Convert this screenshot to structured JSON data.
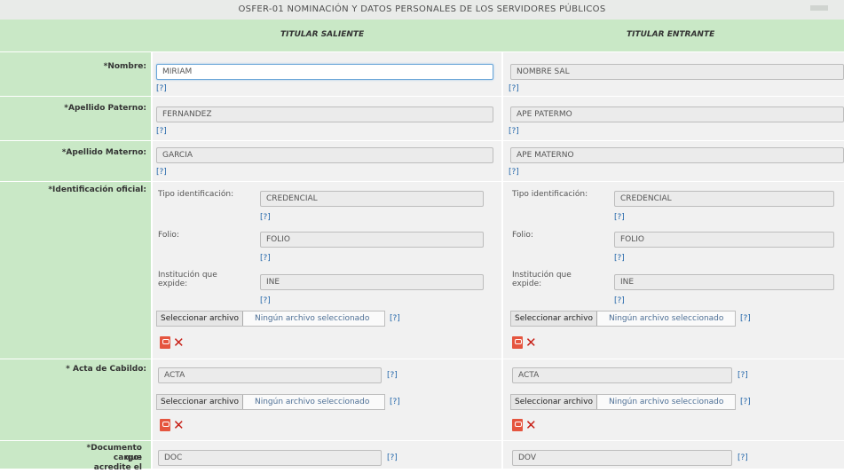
{
  "page": {
    "title": "OSFER-01 NOMINACIÓN Y DATOS PERSONALES DE LOS SERVIDORES PÚBLICOS",
    "col1_header": "TITULAR SALIENTE",
    "col2_header": "TITULAR ENTRANTE"
  },
  "labels": {
    "nombre": "*Nombre:",
    "apellido_paterno": "*Apellido Paterno:",
    "apellido_materno": "*Apellido Materno:",
    "identificacion": "*Identificación oficial:",
    "acta": "* Acta de Cabildo:",
    "documento_line1": "*Documento que acredite el",
    "documento_line2": "cargo:"
  },
  "sub_labels": {
    "tipo": "Tipo identificación:",
    "folio": "Folio:",
    "institucion_line1": "Institución que",
    "institucion_line2": "expide:"
  },
  "help_text": "[?]",
  "file_input": {
    "button_label": "Seleccionar archivo",
    "no_file_text": "Ningún archivo seleccionado"
  },
  "saliente": {
    "nombre": "MIRIAM",
    "apellido_paterno": "FERNANDEZ",
    "apellido_materno": "GARCIA",
    "tipo_identificacion": "CREDENCIAL",
    "folio": "FOLIO",
    "institucion": "INE",
    "acta": "ACTA",
    "documento": "DOC"
  },
  "entrante": {
    "nombre": "NOMBRE SAL",
    "apellido_paterno": "APE PATERMO",
    "apellido_materno": "APE MATERNO",
    "tipo_identificacion": "CREDENCIAL",
    "folio": "FOLIO",
    "institucion": "INE",
    "acta": "ACTA",
    "documento": "DOV"
  },
  "colors": {
    "label_bg": "#c9e8c6",
    "field_bg": "#f1f1f1",
    "help": "#2266aa",
    "delete": "#c71f16"
  },
  "icons": [
    "pdf-icon",
    "delete-icon"
  ]
}
